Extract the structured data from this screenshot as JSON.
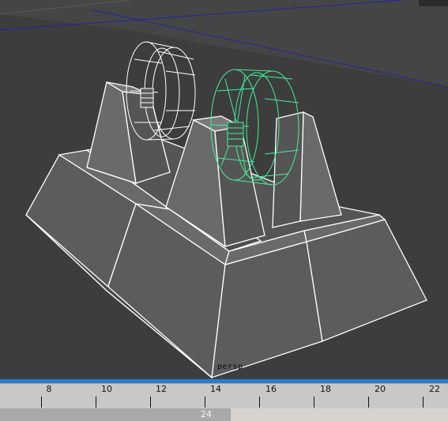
{
  "viewport": {
    "camera_label": "persp",
    "background": "#3d3d3d",
    "wire_color_unselected": "#ffffff",
    "wire_color_selected": "#44ee9a",
    "selection_bar_color": "#2a7bd4"
  },
  "timeline": {
    "ticks": [
      "8",
      "10",
      "12",
      "14",
      "16",
      "18",
      "20",
      "22"
    ]
  },
  "range_slider": {
    "end_value": "24"
  }
}
